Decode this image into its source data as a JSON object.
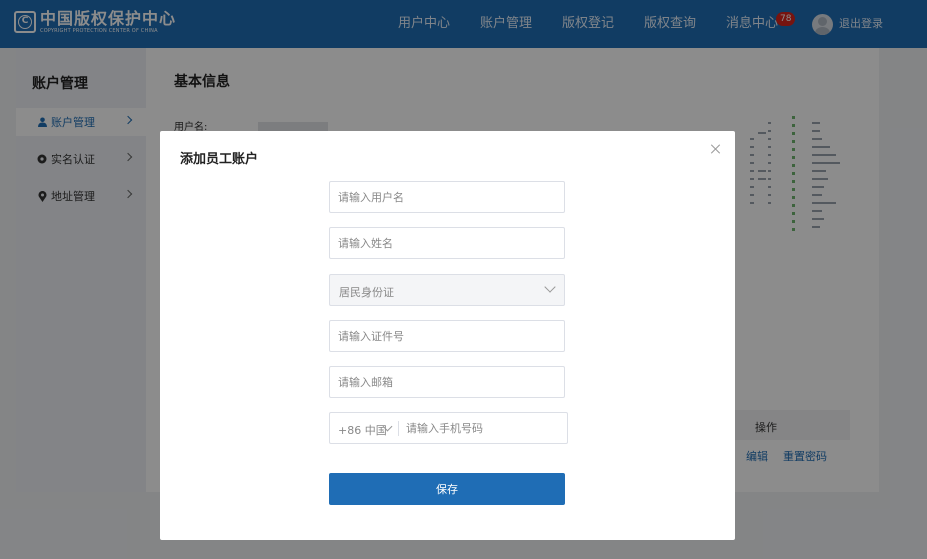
{
  "header": {
    "logo_cn": "中国版权保护中心",
    "logo_en": "COPYRIGHT PROTECTION CENTER OF CHINA",
    "logo_badge": "C",
    "nav": [
      "用户中心",
      "账户管理",
      "版权登记",
      "版权查询",
      "消息中心"
    ],
    "message_count": "78",
    "logout_label": "退出登录"
  },
  "sidebar": {
    "title": "账户管理",
    "items": [
      {
        "label": "账户管理",
        "icon": "user-icon",
        "active": true
      },
      {
        "label": "实名认证",
        "icon": "gear-badge-icon",
        "active": false
      },
      {
        "label": "地址管理",
        "icon": "location-pin-icon",
        "active": false
      }
    ]
  },
  "main": {
    "title": "基本信息",
    "username_label": "用户名:",
    "table_header_action": "操作",
    "row_actions": {
      "edit": "编辑",
      "reset_password": "重置密码"
    }
  },
  "modal": {
    "title": "添加员工账户",
    "username_placeholder": "请输入用户名",
    "name_placeholder": "请输入姓名",
    "id_type_value": "居民身份证",
    "id_number_placeholder": "请输入证件号",
    "email_placeholder": "请输入邮箱",
    "phone_code": "+86 中国",
    "phone_placeholder": "请输入手机号码",
    "save_label": "保存"
  },
  "colors": {
    "brand": "#1f6db5",
    "badge": "#d9261c",
    "overlay": "rgba(0,0,0,0.45)"
  }
}
